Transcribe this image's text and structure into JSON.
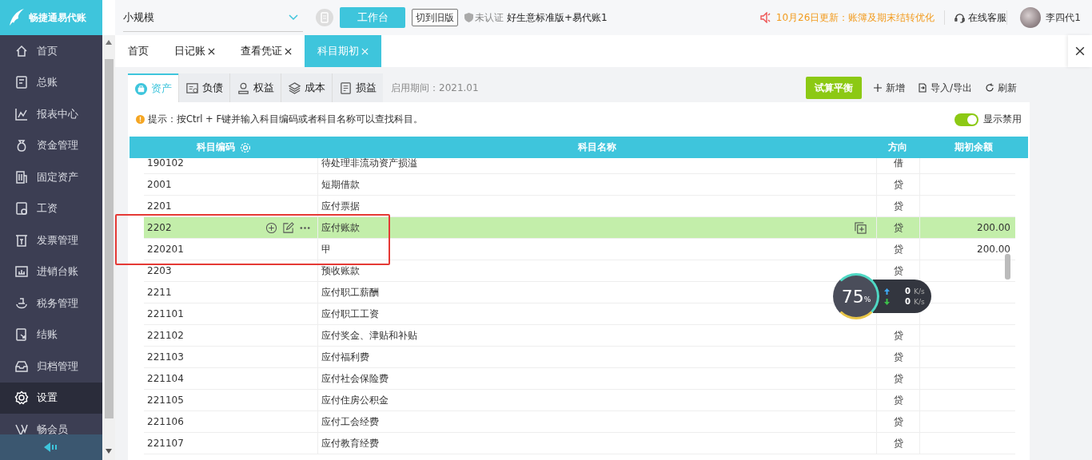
{
  "app": {
    "logo": "畅捷通易代账"
  },
  "topbar": {
    "company": "小规模",
    "workbench_button": "工作台",
    "old_version_button": "切到旧版",
    "cert_status": "未认证",
    "product": "好生意标准版+易代账1",
    "notice": "10月26日更新：账簿及期末结转优化",
    "support": "在线客服",
    "user": "李四代1"
  },
  "sidebar": {
    "items": [
      {
        "label": "首页",
        "selected": false
      },
      {
        "label": "总账",
        "selected": false
      },
      {
        "label": "报表中心",
        "selected": false
      },
      {
        "label": "资金管理",
        "selected": false
      },
      {
        "label": "固定资产",
        "selected": false
      },
      {
        "label": "工资",
        "selected": false
      },
      {
        "label": "发票管理",
        "selected": false
      },
      {
        "label": "进销台账",
        "selected": false
      },
      {
        "label": "税务管理",
        "selected": false
      },
      {
        "label": "结账",
        "selected": false
      },
      {
        "label": "归档管理",
        "selected": false
      },
      {
        "label": "设置",
        "selected": true
      },
      {
        "label": "畅会员",
        "selected": false
      }
    ]
  },
  "tabs": [
    {
      "label": "首页",
      "closable": false,
      "selected": false
    },
    {
      "label": "日记账",
      "closable": true,
      "selected": false
    },
    {
      "label": "查看凭证",
      "closable": true,
      "selected": false
    },
    {
      "label": "科目期初",
      "closable": true,
      "selected": true
    }
  ],
  "category_tabs": [
    {
      "label": "资产",
      "selected": true
    },
    {
      "label": "负债",
      "selected": false
    },
    {
      "label": "权益",
      "selected": false
    },
    {
      "label": "成本",
      "selected": false
    },
    {
      "label": "损益",
      "selected": false
    }
  ],
  "start_period": "启用期间：2021.01",
  "actions": {
    "trial_balance": "试算平衡",
    "add": "新增",
    "import_export": "导入/导出",
    "refresh": "刷新"
  },
  "hint": "提示：按Ctrl + F键并输入科目编码或者科目名称可以查找科目。",
  "show_disabled": {
    "label": "显示禁用",
    "on": true
  },
  "table": {
    "columns": [
      "科目编码",
      "科目名称",
      "方向",
      "期初余额"
    ],
    "rows": [
      {
        "code": "190102",
        "name": "待处理非流动资产损溢",
        "direction": "借",
        "selected": false
      },
      {
        "code": "2001",
        "name": "短期借款",
        "direction": "贷",
        "selected": false
      },
      {
        "code": "2201",
        "name": "应付票据",
        "direction": "贷",
        "selected": false
      },
      {
        "code": "2202",
        "name": "应付账款",
        "direction": "贷",
        "balance": "200.00",
        "selected": true
      },
      {
        "code": "220201",
        "name": "甲",
        "direction": "贷",
        "balance": "200.00",
        "selected": false
      },
      {
        "code": "2203",
        "name": "预收账款",
        "direction": "贷",
        "selected": false
      },
      {
        "code": "2211",
        "name": "应付职工薪酬",
        "selected": false
      },
      {
        "code": "221101",
        "name": "应付职工工资",
        "selected": false
      },
      {
        "code": "221102",
        "name": "应付奖金、津贴和补贴",
        "direction": "贷",
        "selected": false
      },
      {
        "code": "221103",
        "name": "应付福利费",
        "direction": "贷",
        "selected": false
      },
      {
        "code": "221104",
        "name": "应付社会保险费",
        "direction": "贷",
        "selected": false
      },
      {
        "code": "221105",
        "name": "应付住房公积金",
        "direction": "贷",
        "selected": false
      },
      {
        "code": "221106",
        "name": "应付工会经费",
        "direction": "贷",
        "selected": false
      },
      {
        "code": "221107",
        "name": "应付教育经费",
        "direction": "贷",
        "selected": false
      }
    ]
  },
  "net_widget": {
    "percent": "75",
    "unit": "%",
    "up": "0",
    "up_unit": "K/s",
    "down": "0",
    "down_unit": "K/s"
  }
}
